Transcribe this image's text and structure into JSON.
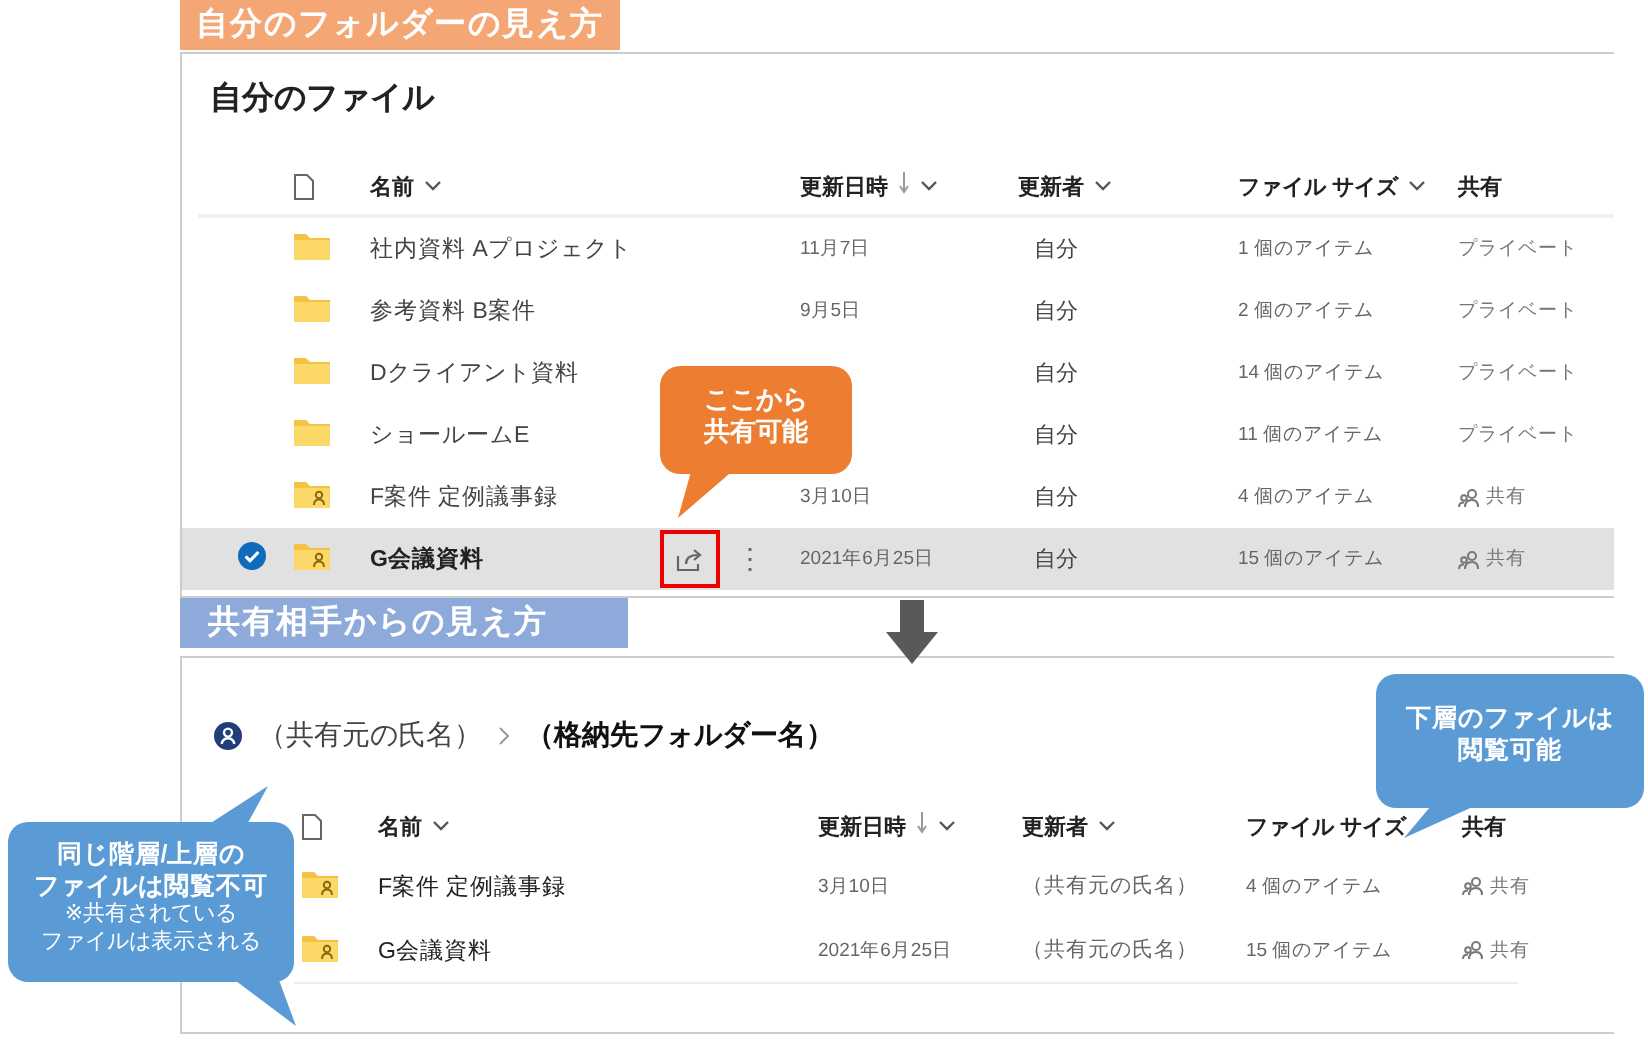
{
  "own_view": {
    "label": "自分のフォルダーの見え方",
    "title": "自分のファイル",
    "columns": [
      {
        "label": "名前",
        "sorted": false,
        "menu": true
      },
      {
        "label": "更新日時",
        "sorted": true,
        "menu": true
      },
      {
        "label": "更新者",
        "sorted": false,
        "menu": true
      },
      {
        "label": "ファイル サイズ",
        "sorted": false,
        "menu": true
      },
      {
        "label": "共有",
        "sorted": false,
        "menu": false
      }
    ],
    "rows": [
      {
        "name": "社内資料 Aプロジェクト",
        "date": "11月7日",
        "modified_by": "自分",
        "size": "1 個のアイテム",
        "sharing": "プライベート",
        "shared": false,
        "selected": false,
        "share_highlighted": false
      },
      {
        "name": "参考資料 B案件",
        "date": "9月5日",
        "modified_by": "自分",
        "size": "2 個のアイテム",
        "sharing": "プライベート",
        "shared": false,
        "selected": false,
        "share_highlighted": false
      },
      {
        "name": "Dクライアント資料",
        "modified_by": "自分",
        "size": "14 個のアイテム",
        "sharing": "プライベート",
        "shared": false,
        "selected": false,
        "share_highlighted": false
      },
      {
        "name": "ショールームE",
        "modified_by": "自分",
        "size": "11 個のアイテム",
        "sharing": "プライベート",
        "shared": false,
        "selected": false,
        "share_highlighted": false
      },
      {
        "name": "F案件 定例議事録",
        "date": "3月10日",
        "modified_by": "自分",
        "size": "4 個のアイテム",
        "sharing": "共有",
        "shared": true,
        "selected": false,
        "share_highlighted": false
      },
      {
        "name": "G会議資料",
        "date": "2021年6月25日",
        "modified_by": "自分",
        "size": "15 個のアイテム",
        "sharing": "共有",
        "shared": true,
        "selected": true,
        "share_highlighted": true
      }
    ],
    "more_button": "⋮",
    "callout": {
      "lines": [
        "ここから",
        "共有可能"
      ]
    }
  },
  "shared_view": {
    "label": "共有相手からの見え方",
    "breadcrumb": [
      {
        "text": "（共有元の氏名）",
        "current": false
      },
      {
        "text": "（格納先フォルダー名）",
        "current": true
      }
    ],
    "columns": [
      {
        "label": "名前",
        "sorted": false,
        "menu": true
      },
      {
        "label": "更新日時",
        "sorted": true,
        "menu": true
      },
      {
        "label": "更新者",
        "sorted": false,
        "menu": true
      },
      {
        "label": "ファイル サイズ",
        "sorted": false,
        "menu": false
      },
      {
        "label": "共有",
        "sorted": false,
        "menu": false
      }
    ],
    "rows": [
      {
        "name": "F案件 定例議事録",
        "date": "3月10日",
        "modified_by": "（共有元の氏名）",
        "size": "4 個のアイテム",
        "sharing": "共有",
        "shared": true
      },
      {
        "name": "G会議資料",
        "date": "2021年6月25日",
        "modified_by": "（共有元の氏名）",
        "size": "15 個のアイテム",
        "sharing": "共有",
        "shared": true
      }
    ],
    "left_callout": {
      "heading": [
        "同じ階層/上層の",
        "ファイルは閲覧不可"
      ],
      "note": [
        "※共有されている",
        "ファイルは表示される"
      ]
    },
    "right_callout": {
      "lines": [
        "下層のファイルは",
        "閲覧可能"
      ]
    }
  }
}
